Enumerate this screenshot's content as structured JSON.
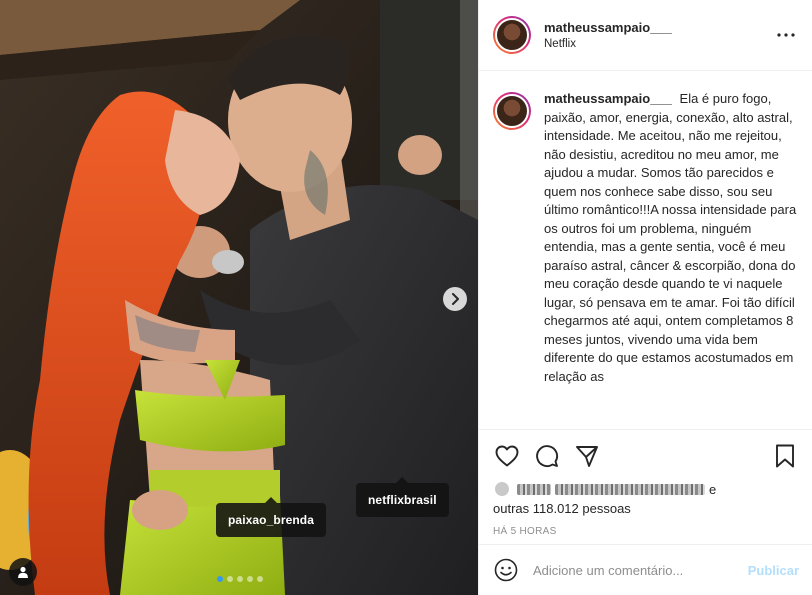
{
  "post": {
    "username": "matheussampaio___",
    "location": "Netflix",
    "caption_username": "matheussampaio___",
    "caption": "Ela é puro fogo, paixão, amor, energia, conexão, alto astral, intensidade. Me aceitou, não me rejeitou, não desistiu, acreditou no meu amor, me ajudou a mudar. Somos tão parecidos e quem nos conhece sabe disso, sou seu último romântico!!!A nossa intensidade para os outros foi um problema, ninguém entendia, mas a gente sentia, você é meu paraíso astral, câncer & escorpião, dona do meu coração desde quando te vi naquele lugar, só pensava em te amar. Foi tão difícil chegarmos até aqui, ontem completamos 8 meses juntos, vivendo uma vida bem diferente do que estamos acostumados em relação as"
  },
  "photo": {
    "tags": [
      "paixao_brenda",
      "netflixbrasil"
    ],
    "carousel": {
      "current": 1,
      "total": 5
    }
  },
  "icons": {
    "more": "more-options-icon",
    "next": "chevron-right-icon",
    "user_tag": "person-icon",
    "like": "heart-icon",
    "comment": "comment-icon",
    "share": "paper-plane-icon",
    "save": "bookmark-icon",
    "emoji": "smiley-icon"
  },
  "likes": {
    "and_text": "e",
    "others_text": "outras 118.012 pessoas"
  },
  "time": "HÁ 5 HORAS",
  "comment": {
    "placeholder": "Adicione um comentário...",
    "publish_label": "Publicar"
  },
  "colors": {
    "accent_blue": "#3897f0",
    "publish_disabled": "#b2dffc",
    "hair": "#e8531e",
    "dress": "#b6d62a"
  }
}
